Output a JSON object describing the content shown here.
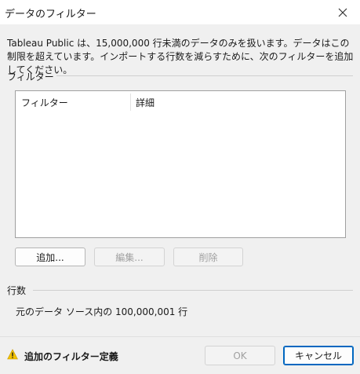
{
  "dialog": {
    "title": "データのフィルター",
    "description": "Tableau Public は、15,000,000 行未満のデータのみを扱います。データはこの制限を超えています。インポートする行数を減らすために、次のフィルターを追加してください。"
  },
  "filters": {
    "group_label": "フィルター",
    "columns": [
      "フィルター",
      "詳細"
    ],
    "add_label": "追加...",
    "edit_label": "編集...",
    "remove_label": "削除"
  },
  "rows": {
    "group_label": "行数",
    "text": "元のデータ ソース内の 100,000,001 行"
  },
  "footer": {
    "warning": "追加のフィルター定義",
    "ok_label": "OK",
    "cancel_label": "キャンセル"
  },
  "colors": {
    "warning": "#f2c200",
    "primary_border": "#0067c0"
  }
}
